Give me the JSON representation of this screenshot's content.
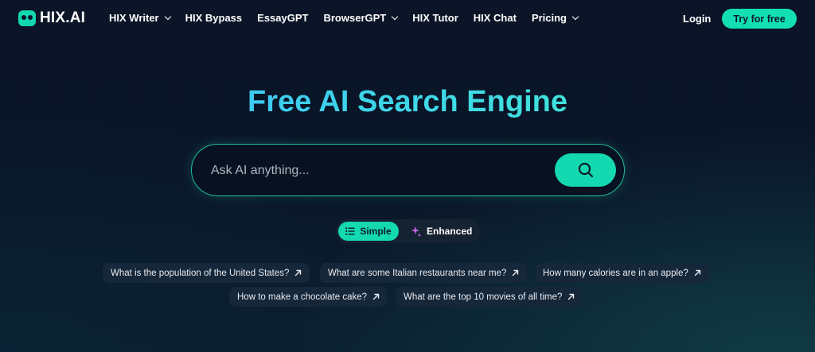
{
  "brand": {
    "name": "HIX.AI"
  },
  "nav": {
    "items": [
      {
        "label": "HIX Writer",
        "dropdown": true
      },
      {
        "label": "HIX Bypass",
        "dropdown": false
      },
      {
        "label": "EssayGPT",
        "dropdown": false
      },
      {
        "label": "BrowserGPT",
        "dropdown": true
      },
      {
        "label": "HIX Tutor",
        "dropdown": false
      },
      {
        "label": "HIX Chat",
        "dropdown": false
      },
      {
        "label": "Pricing",
        "dropdown": true
      }
    ],
    "login_label": "Login",
    "cta_label": "Try for free"
  },
  "hero": {
    "title": "Free AI Search Engine",
    "search": {
      "placeholder": "Ask AI anything...",
      "value": ""
    }
  },
  "modes": {
    "simple_label": "Simple",
    "enhanced_label": "Enhanced",
    "selected": "Simple"
  },
  "suggestions": [
    "What is the population of the United States?",
    "What are some Italian restaurants near me?",
    "How many calories are in an apple?",
    "How to make a chocolate cake?",
    "What are the top 10 movies of all time?"
  ],
  "colors": {
    "accent": "#14d9b0",
    "background": "#0b1527",
    "chip": "#16273a"
  }
}
